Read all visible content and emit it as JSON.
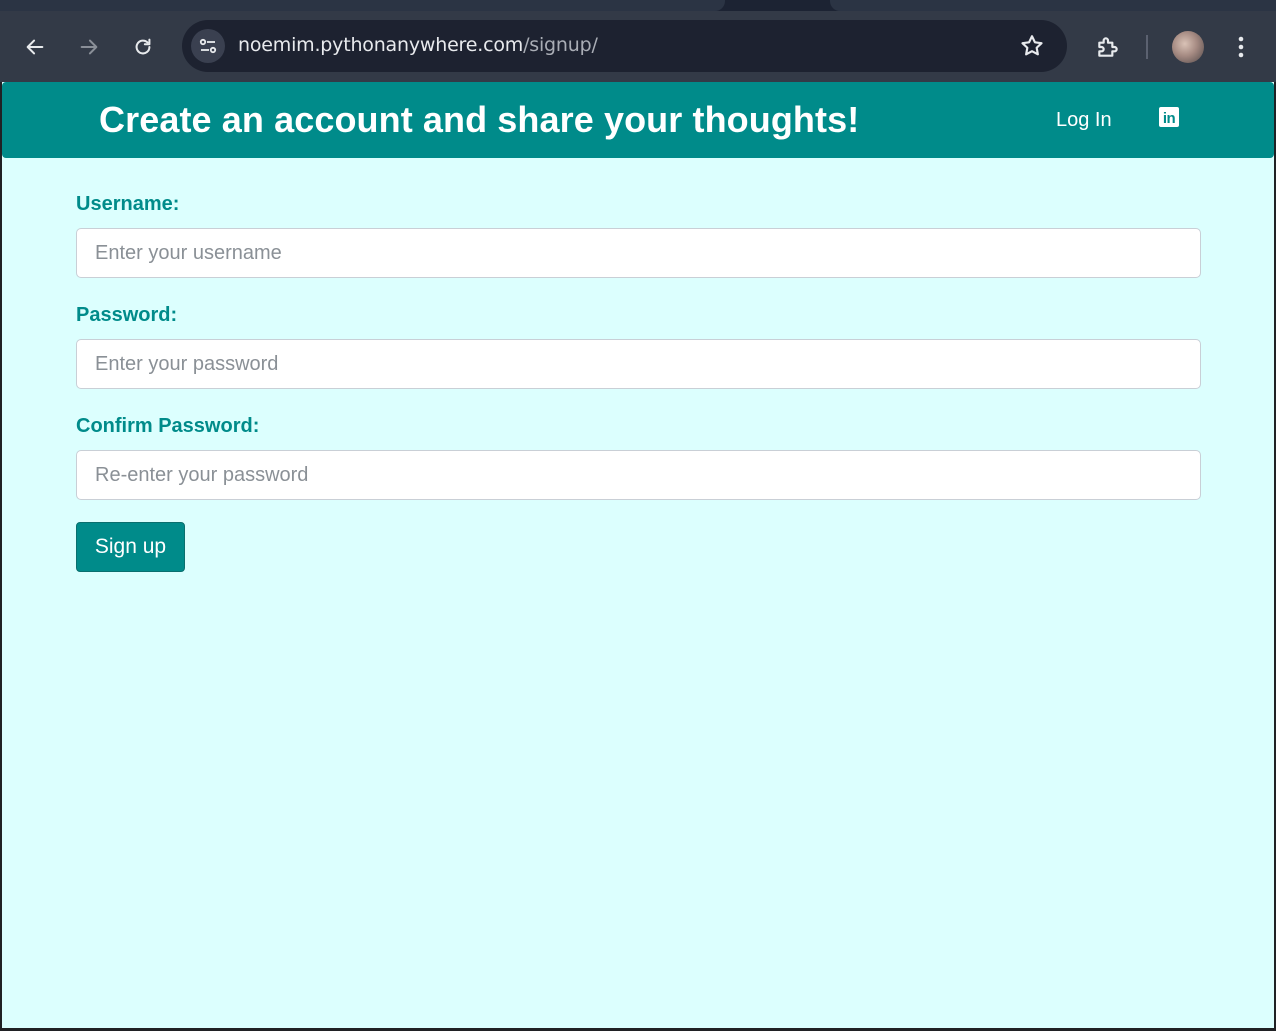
{
  "browser": {
    "url_host": "noemim.pythonanywhere.com",
    "url_path": "/signup/",
    "icons": {
      "back": "back-arrow-icon",
      "forward": "forward-arrow-icon",
      "reload": "reload-icon",
      "site_info": "site-info-icon",
      "bookmark": "star-icon",
      "extensions": "puzzle-icon",
      "profile": "avatar",
      "menu": "kebab-menu-icon"
    }
  },
  "navbar": {
    "title": "Create an account and share your thoughts!",
    "login_label": "Log In",
    "linkedin_icon_text": "in"
  },
  "form": {
    "username": {
      "label": "Username:",
      "placeholder": "Enter your username",
      "value": ""
    },
    "password": {
      "label": "Password:",
      "placeholder": "Enter your password",
      "value": ""
    },
    "confirm_password": {
      "label": "Confirm Password:",
      "placeholder": "Re-enter your password",
      "value": ""
    },
    "submit_label": "Sign up"
  },
  "colors": {
    "accent": "#008b8a",
    "page_background": "#dcfffe",
    "browser_toolbar": "#333a47"
  }
}
